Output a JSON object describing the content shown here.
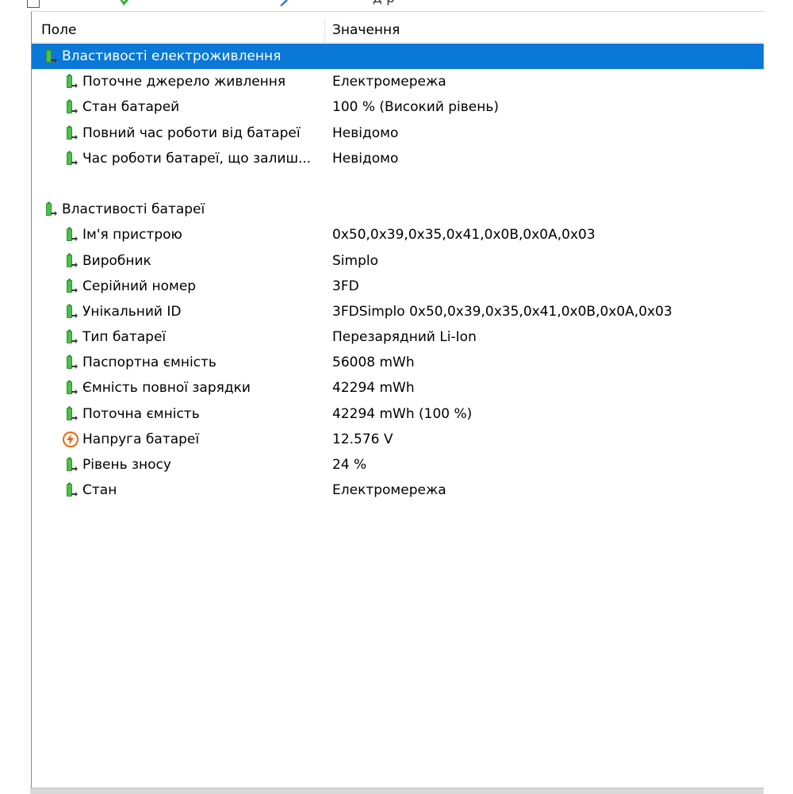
{
  "toolbar": {
    "partial_text": "д   р"
  },
  "columns": {
    "field": "Поле",
    "value": "Значення"
  },
  "sections": [
    {
      "title": "Властивості електроживлення",
      "selected": true,
      "items": [
        {
          "field": "Поточне джерело живлення",
          "value": "Електромережа",
          "icon": "battery-icon"
        },
        {
          "field": "Стан батарей",
          "value": "100 % (Високий рівень)",
          "icon": "battery-icon"
        },
        {
          "field": "Повний час роботи від батареї",
          "value": "Невідомо",
          "icon": "battery-icon"
        },
        {
          "field": "Час роботи батареї, що залиш...",
          "value": "Невідомо",
          "icon": "battery-icon"
        }
      ]
    },
    {
      "title": "Властивості батареї",
      "selected": false,
      "items": [
        {
          "field": "Ім'я пристрою",
          "value": "0x50,0x39,0x35,0x41,0x0B,0x0A,0x03",
          "icon": "battery-icon"
        },
        {
          "field": "Виробник",
          "value": "Simplo",
          "icon": "battery-icon"
        },
        {
          "field": "Серійний номер",
          "value": "3FD",
          "icon": "battery-icon"
        },
        {
          "field": "Унікальний ID",
          "value": "3FDSimplo 0x50,0x39,0x35,0x41,0x0B,0x0A,0x03",
          "icon": "battery-icon"
        },
        {
          "field": "Тип батареї",
          "value": "Перезарядний Li-Ion",
          "icon": "battery-icon"
        },
        {
          "field": "Паспортна ємність",
          "value": "56008 mWh",
          "icon": "battery-icon"
        },
        {
          "field": "Ємність повної зарядки",
          "value": "42294 mWh",
          "icon": "battery-icon"
        },
        {
          "field": "Поточна ємність",
          "value": "42294 mWh  (100 %)",
          "icon": "battery-icon"
        },
        {
          "field": "Напруга батареї",
          "value": "12.576 V",
          "icon": "voltage-icon"
        },
        {
          "field": "Рівень зносу",
          "value": "24 %",
          "icon": "battery-icon"
        },
        {
          "field": "Стан",
          "value": "Електромережа",
          "icon": "battery-icon"
        }
      ]
    }
  ],
  "colors": {
    "selection": "#0a78d7",
    "battery_green": "#3aa33a",
    "voltage_orange": "#e86a10"
  }
}
